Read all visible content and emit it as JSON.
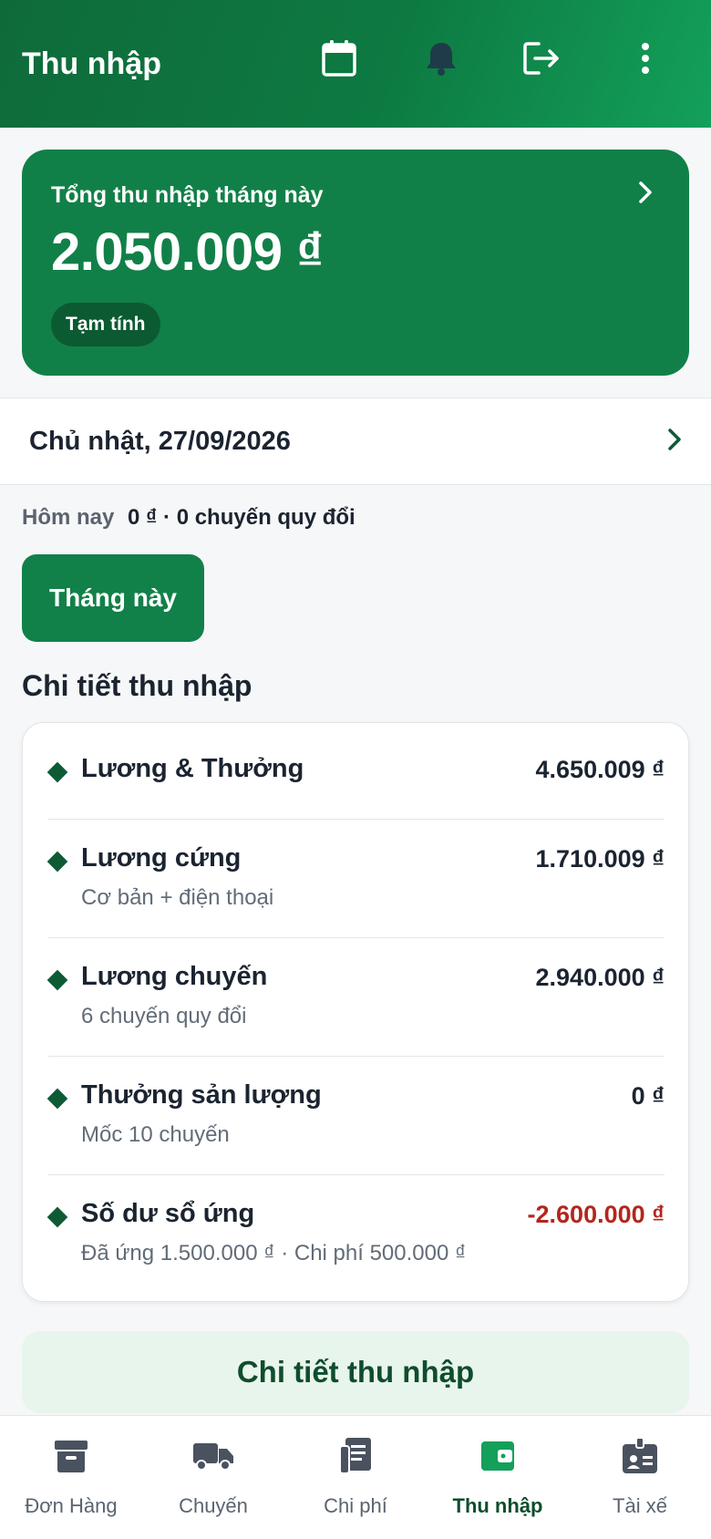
{
  "header": {
    "title": "Thu nhập",
    "icons": [
      "calendar-icon",
      "bell-icon",
      "logout-icon",
      "more-vertical-icon"
    ]
  },
  "summary": {
    "label": "Tổng thu nhập tháng này",
    "amount": "2.050.009 ₫",
    "badge": "Tạm tính"
  },
  "date": {
    "text": "Chủ nhật, 27/09/2026"
  },
  "today": {
    "label": "Hôm nay",
    "value": "0 ₫ · 0 chuyến quy đổi"
  },
  "period_button": "Tháng này",
  "section_title": "Chi tiết thu nhập",
  "details": [
    {
      "label": "Lương & Thưởng",
      "sub": "",
      "value": "4.650.009 ₫",
      "negative": false
    },
    {
      "label": "Lương cứng",
      "sub": "Cơ bản + điện thoại",
      "value": "1.710.009 ₫",
      "negative": false
    },
    {
      "label": "Lương chuyến",
      "sub": "6 chuyến quy đổi",
      "value": "2.940.000 ₫",
      "negative": false
    },
    {
      "label": "Thưởng sản lượng",
      "sub": "Mốc 10 chuyến",
      "value": "0 ₫",
      "negative": false
    },
    {
      "label": "Số dư sổ ứng",
      "sub": "Đã ứng 1.500.000 ₫ · Chi phí 500.000 ₫",
      "value": "-2.600.000 ₫",
      "negative": true
    }
  ],
  "detail_button": "Chi tiết thu nhập",
  "nav": [
    {
      "label": "Đơn Hàng",
      "icon": "archive-box-icon",
      "active": false
    },
    {
      "label": "Chuyến",
      "icon": "truck-icon",
      "active": false
    },
    {
      "label": "Chi phí",
      "icon": "receipt-icon",
      "active": false
    },
    {
      "label": "Thu nhập",
      "icon": "wallet-icon",
      "active": true
    },
    {
      "label": "Tài xế",
      "icon": "id-badge-icon",
      "active": false
    }
  ],
  "colors": {
    "brand": "#118048",
    "header_gradient_start": "#0f6a3a",
    "header_gradient_end": "#13a05a",
    "negative": "#b3261e",
    "active_nav": "#0f4d2c",
    "inactive_icon": "#4a5260"
  }
}
